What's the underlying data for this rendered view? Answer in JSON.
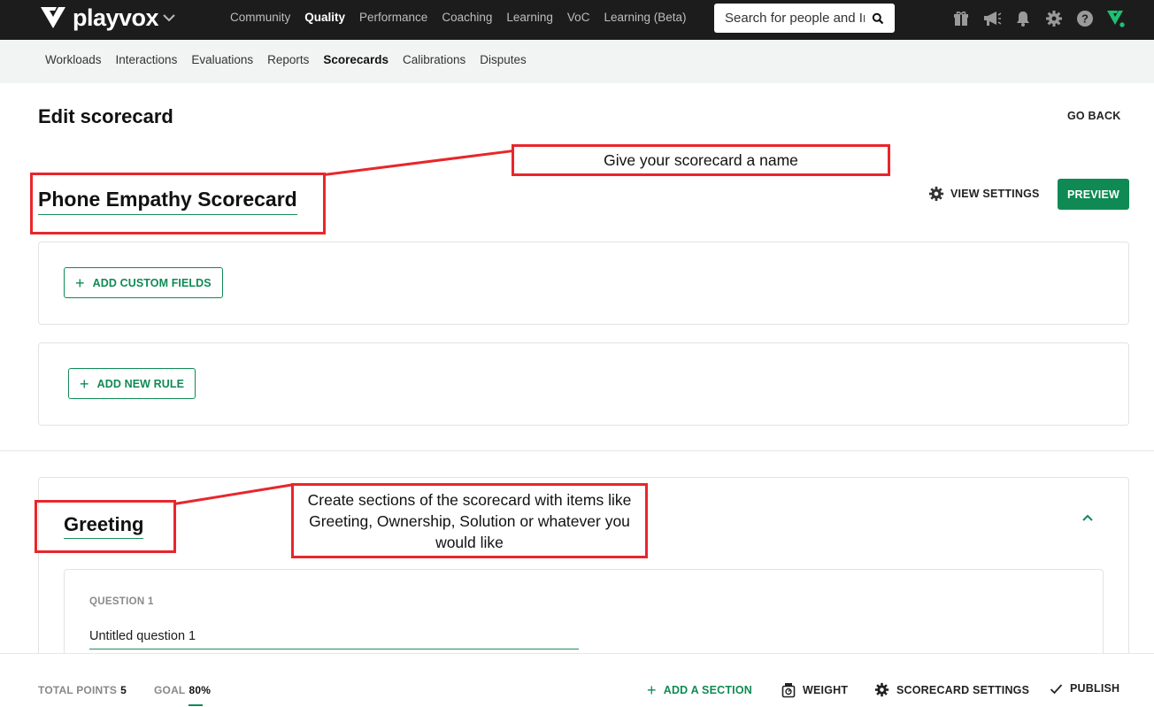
{
  "app": {
    "logo_text": "playvox"
  },
  "main_nav": [
    {
      "label": "Community",
      "active": false
    },
    {
      "label": "Quality",
      "active": true
    },
    {
      "label": "Performance",
      "active": false
    },
    {
      "label": "Coaching",
      "active": false
    },
    {
      "label": "Learning",
      "active": false
    },
    {
      "label": "VoC",
      "active": false
    },
    {
      "label": "Learning (Beta)",
      "active": false
    }
  ],
  "search": {
    "placeholder": "Search for people and Inter",
    "icon": "search-icon"
  },
  "top_icons": [
    "gift-icon",
    "megaphone-icon",
    "bell-icon",
    "gear-icon",
    "help-icon",
    "playvox-status-icon"
  ],
  "sub_nav": [
    {
      "label": "Workloads",
      "active": false
    },
    {
      "label": "Interactions",
      "active": false
    },
    {
      "label": "Evaluations",
      "active": false
    },
    {
      "label": "Reports",
      "active": false
    },
    {
      "label": "Scorecards",
      "active": true
    },
    {
      "label": "Calibrations",
      "active": false
    },
    {
      "label": "Disputes",
      "active": false
    }
  ],
  "page": {
    "title": "Edit scorecard",
    "go_back": "GO BACK",
    "scorecard_name": "Phone Empathy Scorecard",
    "view_settings": "VIEW SETTINGS",
    "preview": "PREVIEW",
    "add_custom_fields": "ADD CUSTOM FIELDS",
    "add_new_rule": "ADD NEW RULE"
  },
  "section": {
    "title": "Greeting",
    "question_label": "QUESTION 1",
    "question_value": "Untitled question 1"
  },
  "annotations": {
    "name_note": "Give your scorecard a name",
    "section_note": "Create sections of the scorecard with items like Greeting, Ownership, Solution or whatever you would like"
  },
  "footer": {
    "total_points_label": "TOTAL POINTS",
    "total_points_value": "5",
    "goal_label": "GOAL",
    "goal_value": "80%",
    "add_section": "ADD A SECTION",
    "weight": "WEIGHT",
    "scorecard_settings": "SCORECARD SETTINGS",
    "publish": "PUBLISH"
  },
  "colors": {
    "accent": "#0f8a54",
    "topbar": "#1c1c1c",
    "annotation": "#e8262b"
  }
}
